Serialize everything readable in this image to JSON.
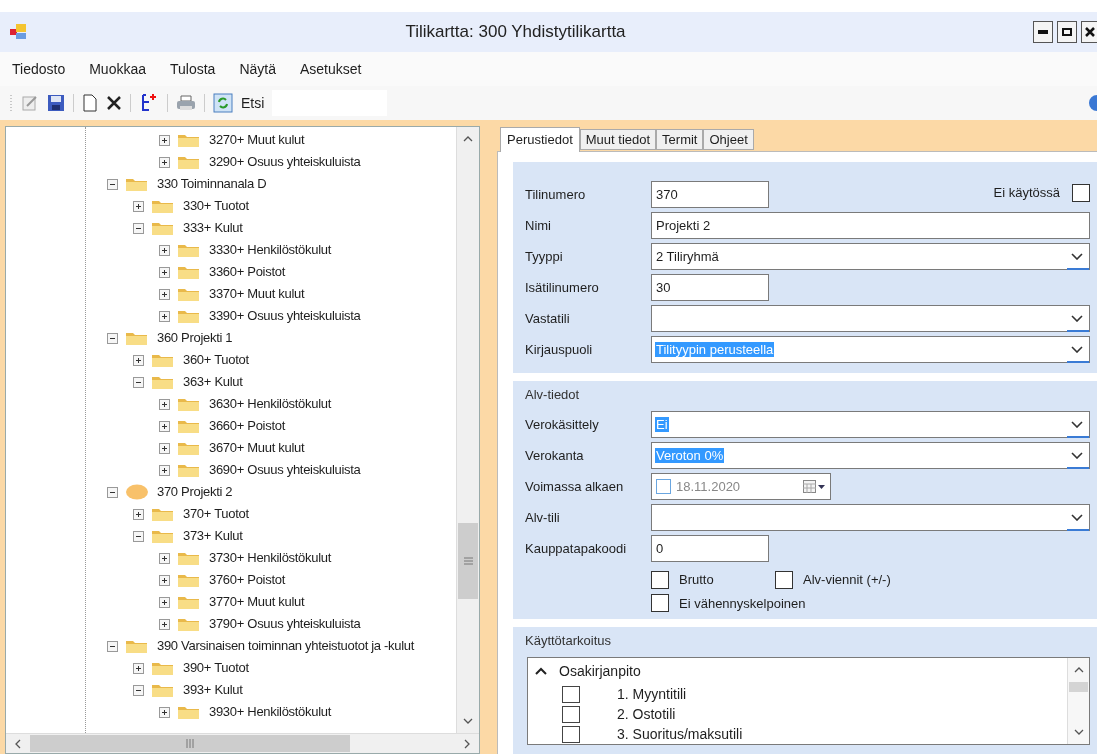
{
  "window": {
    "title": "Tilikartta: 300 Yhdistytilikartta"
  },
  "menu": [
    "Tiedosto",
    "Muokkaa",
    "Tulosta",
    "Näytä",
    "Asetukset"
  ],
  "toolbar": {
    "search_label": "Etsi"
  },
  "tree": {
    "items": [
      {
        "children": [
          {
            "children": [
              {
                "label": "3270+ Muut kulut",
                "expanded": false,
                "selected": false
              },
              {
                "label": "3290+ Osuus yhteiskuluista",
                "expanded": false,
                "selected": false
              }
            ]
          }
        ]
      },
      {
        "label": "330 Toiminnanala D",
        "expanded": true,
        "selected": false,
        "children": [
          {
            "label": "330+ Tuotot",
            "expanded": false,
            "selected": false
          },
          {
            "label": "333+ Kulut",
            "expanded": true,
            "selected": false,
            "children": [
              {
                "label": "3330+ Henkilöstökulut",
                "expanded": false,
                "selected": false
              },
              {
                "label": "3360+ Poistot",
                "expanded": false,
                "selected": false
              },
              {
                "label": "3370+ Muut kulut",
                "expanded": false,
                "selected": false
              },
              {
                "label": "3390+ Osuus yhteiskuluista",
                "expanded": false,
                "selected": false
              }
            ]
          }
        ]
      },
      {
        "label": "360 Projekti 1",
        "expanded": true,
        "selected": false,
        "children": [
          {
            "label": "360+ Tuotot",
            "expanded": false,
            "selected": false
          },
          {
            "label": "363+ Kulut",
            "expanded": true,
            "selected": false,
            "children": [
              {
                "label": "3630+ Henkilöstökulut",
                "expanded": false,
                "selected": false
              },
              {
                "label": "3660+ Poistot",
                "expanded": false,
                "selected": false
              },
              {
                "label": "3670+ Muut kulut",
                "expanded": false,
                "selected": false
              },
              {
                "label": "3690+ Osuus yhteiskuluista",
                "expanded": false,
                "selected": false
              }
            ]
          }
        ]
      },
      {
        "label": "370 Projekti 2",
        "expanded": true,
        "selected": true,
        "children": [
          {
            "label": "370+ Tuotot",
            "expanded": false,
            "selected": false
          },
          {
            "label": "373+ Kulut",
            "expanded": true,
            "selected": false,
            "children": [
              {
                "label": "3730+ Henkilöstökulut",
                "expanded": false,
                "selected": false
              },
              {
                "label": "3760+ Poistot",
                "expanded": false,
                "selected": false
              },
              {
                "label": "3770+ Muut kulut",
                "expanded": false,
                "selected": false
              },
              {
                "label": "3790+ Osuus yhteiskuluista",
                "expanded": false,
                "selected": false
              }
            ]
          }
        ]
      },
      {
        "label": "390 Varsinaisen toiminnan yhteistuotot ja -kulut",
        "expanded": true,
        "selected": false,
        "children": [
          {
            "label": "390+ Tuotot",
            "expanded": false,
            "selected": false
          },
          {
            "label": "393+ Kulut",
            "expanded": true,
            "selected": false,
            "children": [
              {
                "label": "3930+ Henkilöstökulut",
                "expanded": false,
                "selected": false
              }
            ]
          }
        ]
      }
    ]
  },
  "tabs": [
    {
      "label": "Perustiedot",
      "selected": true
    },
    {
      "label": "Muut tiedot",
      "selected": false
    },
    {
      "label": "Termit",
      "selected": false
    },
    {
      "label": "Ohjeet",
      "selected": false
    }
  ],
  "basic": {
    "not_in_use": {
      "label": "Ei käytössä",
      "checked": false
    },
    "fields": [
      {
        "kind": "short",
        "label": "Tilinumero",
        "value": "370"
      },
      {
        "kind": "wide",
        "label": "Nimi",
        "value": "Projekti 2"
      },
      {
        "kind": "select",
        "label": "Tyyppi",
        "value": "2 Tiliryhmä",
        "highlighted": false
      },
      {
        "kind": "short",
        "label": "Isätilinumero",
        "value": "30"
      },
      {
        "kind": "select",
        "label": "Vastatili"
      },
      {
        "kind": "select",
        "label": "Kirjauspuoli",
        "value": "Tilityypin perusteella",
        "highlighted": true
      }
    ]
  },
  "vat": {
    "title": "Alv-tiedot",
    "fields": [
      {
        "kind": "select",
        "label": "Verokäsittely",
        "value": "Ei",
        "highlighted": true
      },
      {
        "kind": "select",
        "label": "Verokanta",
        "value": "Veroton 0%",
        "highlighted": true
      },
      {
        "kind": "date",
        "label": "Voimassa alkaen",
        "value": "18.11.2020",
        "checked": false
      },
      {
        "kind": "select",
        "label": "Alv-tili"
      },
      {
        "kind": "short",
        "label": "Kauppatapakoodi",
        "value": "0"
      }
    ],
    "checkbox_rows": [
      [
        {
          "label": "Brutto",
          "checked": false
        },
        {
          "label": "Alv-viennit (+/-)",
          "checked": false
        }
      ],
      [
        {
          "label": "Ei vähennyskelpoinen",
          "checked": false
        }
      ]
    ]
  },
  "usage": {
    "title": "Käyttötarkoitus",
    "group": {
      "label": "Osakirjanpito",
      "expanded": true
    },
    "items": [
      {
        "label": "1. Myyntitili",
        "checked": false
      },
      {
        "label": "2. Ostotili",
        "checked": false
      },
      {
        "label": "3. Suoritus/maksutili",
        "checked": false
      }
    ]
  }
}
